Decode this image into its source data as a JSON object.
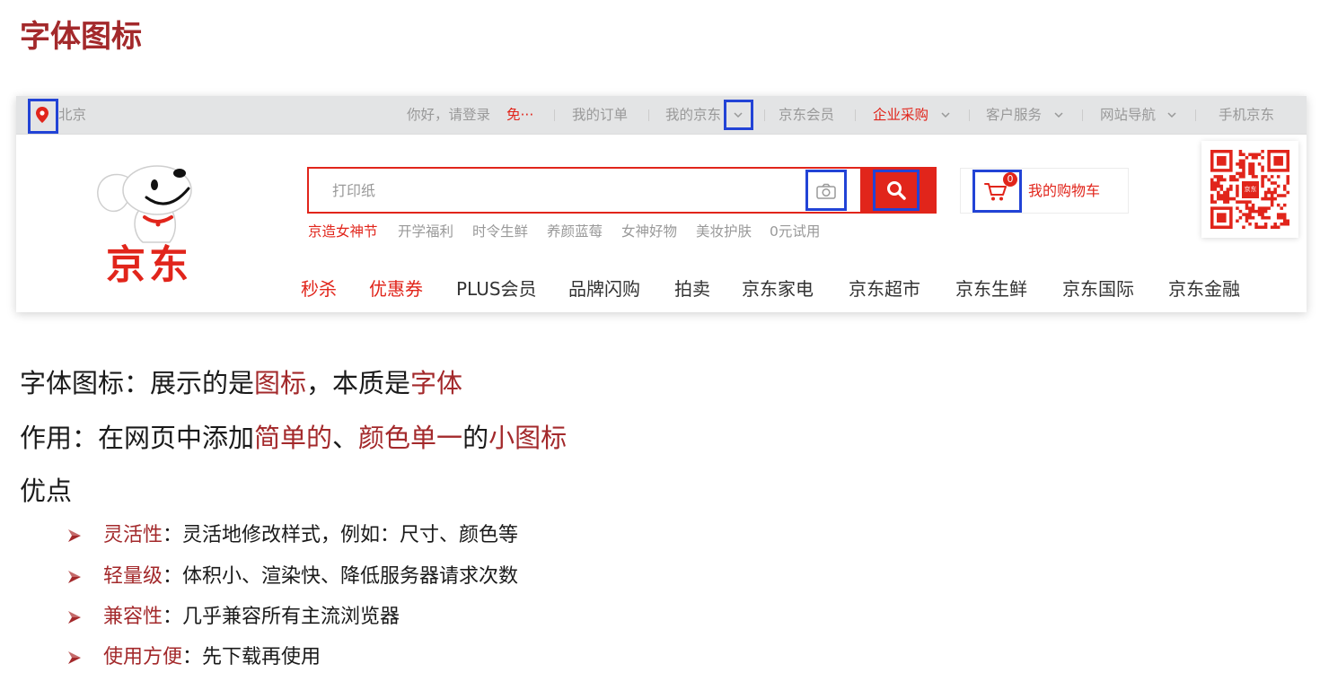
{
  "colors": {
    "slide_accent": "#a3292b",
    "slide_text": "#1a1a1a",
    "jd_red": "#e1251b",
    "annotation_blue": "#2243d6",
    "topbar_bg": "#e3e4e5",
    "muted_text": "#999999"
  },
  "slide": {
    "title": "字体图标",
    "intro": [
      "字体图标：展示的是",
      "图标",
      "，本质是",
      "字体"
    ],
    "purpose": [
      "作用：在网页中添加",
      "简单的",
      "、",
      "颜色单一",
      "的",
      "小图标"
    ],
    "advantages_heading": "优点",
    "advantages": [
      {
        "term": "灵活性",
        "desc": "：灵活地修改样式，例如：尺寸、颜色等"
      },
      {
        "term": "轻量级",
        "desc": "：体积小、渲染快、降低服务器请求次数"
      },
      {
        "term": "兼容性",
        "desc": "：几乎兼容所有主流浏览器"
      },
      {
        "term": "使用方便",
        "desc": "：先下载再使用"
      }
    ]
  },
  "jd_header": {
    "topbar": {
      "location_icon": "location-pin-icon",
      "location": "北京",
      "greeting": "你好，请登录",
      "register": "免···",
      "links": [
        "我的订单",
        "我的京东",
        "京东会员",
        "企业采购",
        "客户服务",
        "网站导航",
        "手机京东"
      ]
    },
    "logo": {
      "text": "京东",
      "mascot_icon": "jd-joy-dog-mascot"
    },
    "search": {
      "placeholder": "打印纸",
      "camera_icon": "camera-icon",
      "search_icon": "search-icon"
    },
    "hot_words": [
      "京造女神节",
      "开学福利",
      "时令生鲜",
      "养颜蓝莓",
      "女神好物",
      "美妆护肤",
      "0元试用"
    ],
    "cart": {
      "label": "我的购物车",
      "count": "0",
      "icon": "shopping-cart-icon"
    },
    "qr": {
      "logo_text": "京东"
    },
    "nav": [
      "秒杀",
      "优惠券",
      "PLUS会员",
      "品牌闪购",
      "拍卖",
      "京东家电",
      "京东超市",
      "京东生鲜",
      "京东国际",
      "京东金融"
    ]
  }
}
